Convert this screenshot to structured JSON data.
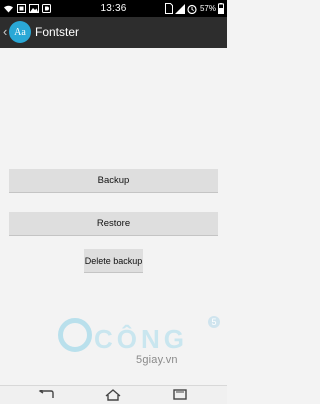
{
  "status_bar": {
    "time": "13:36",
    "battery_percent": "57%",
    "icons": [
      "wifi-icon",
      "screen-icon",
      "image-icon",
      "d-icon",
      "sim-icon",
      "signal-icon",
      "alarm-icon",
      "battery-icon"
    ]
  },
  "action_bar": {
    "app_title": "Fontster",
    "app_icon_text": "Aa"
  },
  "buttons": {
    "backup": "Backup",
    "restore": "Restore",
    "delete_backup": "Delete backup"
  },
  "watermark": {
    "word": "CÔNG",
    "sub": "5giay.vn",
    "badge": "5"
  },
  "colors": {
    "status_bar": "#000000",
    "action_bar": "#2d2d2d",
    "app_icon": "#2aa8d6",
    "background": "#f3f3f3",
    "button": "#dedede"
  }
}
